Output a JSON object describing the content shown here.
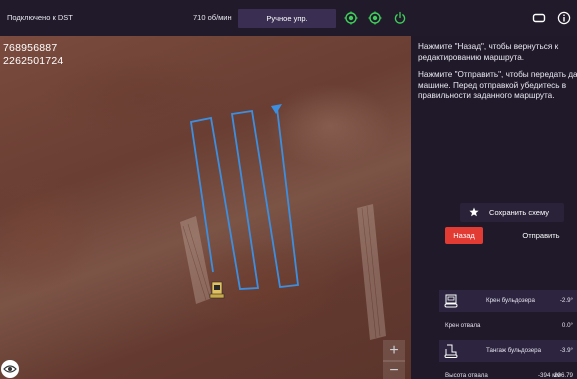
{
  "topbar": {
    "connection_status": "Подключено к DST",
    "rpm": "710 об/мин",
    "mode_button": "Ручное упр."
  },
  "map": {
    "coord_line_1": "768956887",
    "coord_line_2": "2262501724",
    "zoom_in_label": "+",
    "zoom_out_label": "−",
    "route_color": "#3c8fe0"
  },
  "panel": {
    "message_back": [
      "Нажмите \"Назад\", чтобы вернуться к",
      "редактированию маршрута."
    ],
    "message_send": [
      "Нажмите \"Отправить\", чтобы передать да",
      "машине. Перед отправкой убедитесь в",
      "правильности заданного маршрута."
    ],
    "save_scheme_label": "Сохранить схему",
    "back_label": "Назад",
    "send_label": "Отправить",
    "sensors": {
      "bulldozer_roll_label": "Крен бульдозера",
      "bulldozer_roll_value": "-2.9°",
      "blade_roll_label": "Крен отвала",
      "blade_roll_value": "0.0°",
      "bulldozer_pitch_label": "Тангаж бульдозера",
      "bulldozer_pitch_value": "-3.9°",
      "blade_height_label": "Высота отвала",
      "blade_height_value": "-394 мм",
      "blade_height_extra": "206.79"
    }
  },
  "colors": {
    "accent_purple": "#3a2f52",
    "back_red": "#e23b33",
    "status_green": "#3fcf5a"
  },
  "icons": [
    "gps-target-icon",
    "gps-target-icon",
    "power-icon",
    "display-icon",
    "info-icon",
    "star-icon",
    "bulldozer-icon",
    "eye-icon"
  ]
}
